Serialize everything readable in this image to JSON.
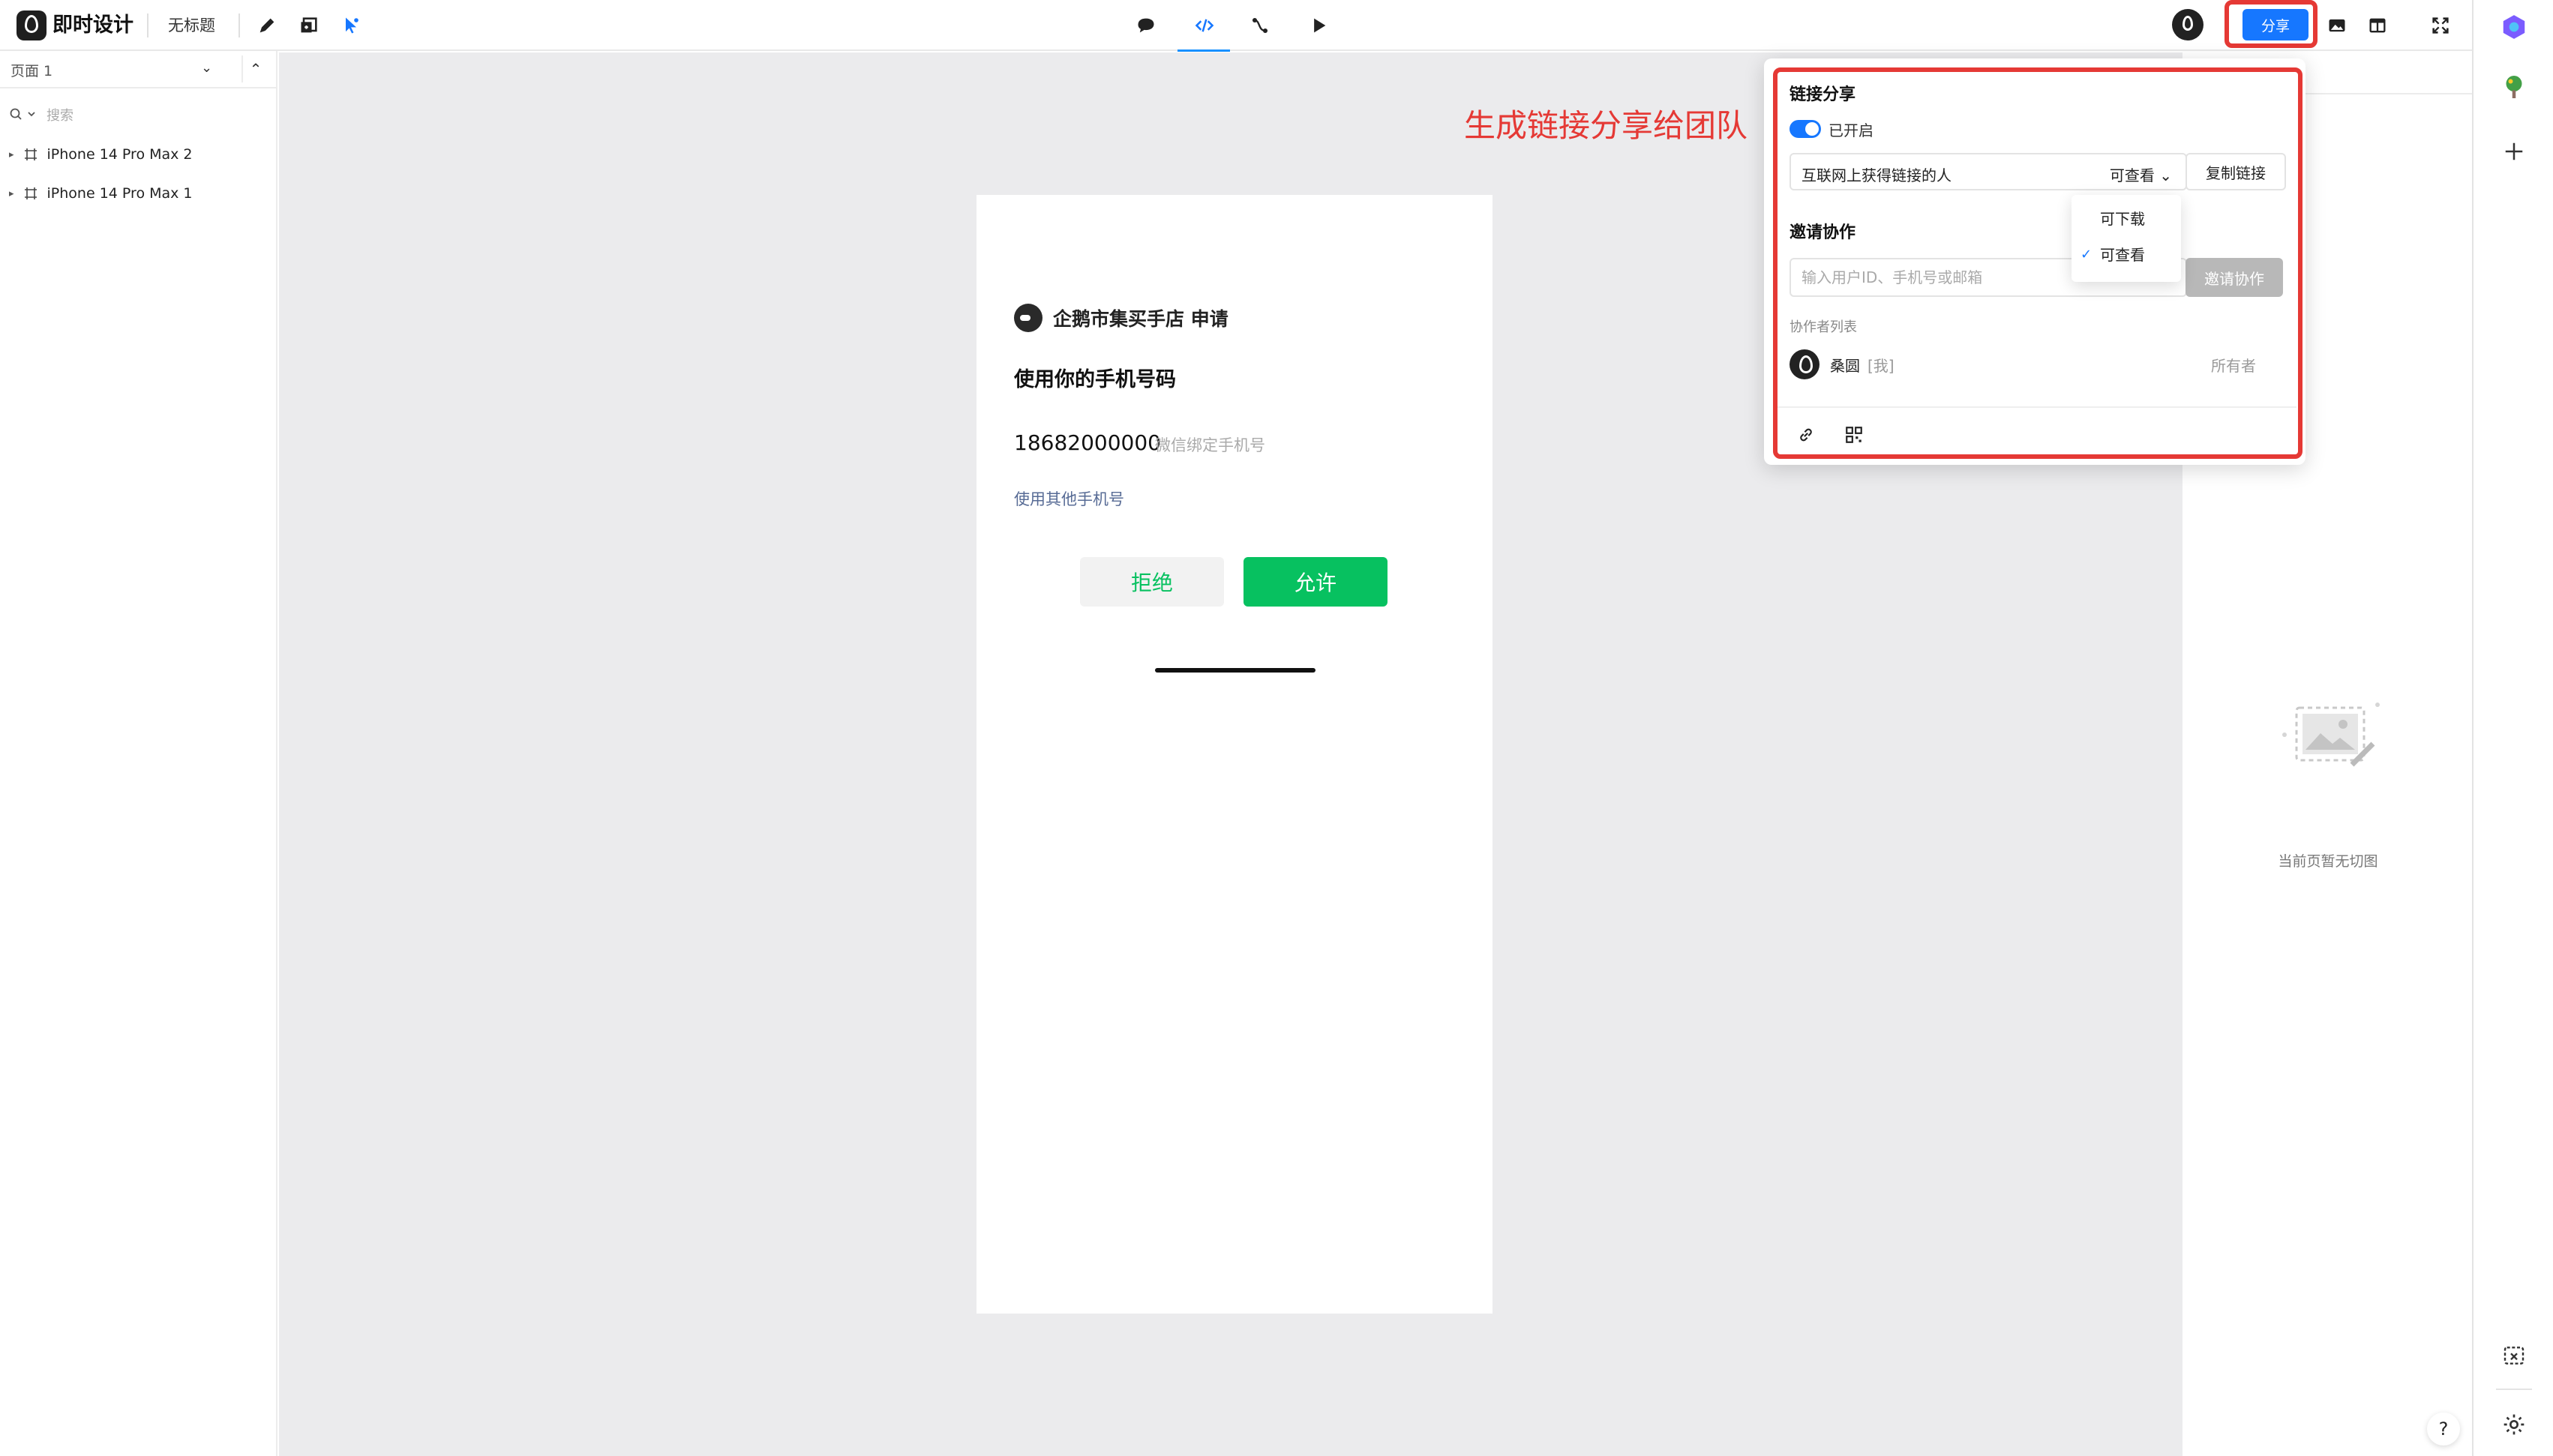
{
  "app": {
    "name": "即时设计",
    "doc_title": "无标题",
    "share_label": "分享"
  },
  "leftpanel": {
    "page_label": "页面 1",
    "search_placeholder": "搜索",
    "layers": [
      {
        "label": "iPhone 14 Pro Max 2"
      },
      {
        "label": "iPhone 14 Pro Max 1"
      }
    ]
  },
  "phone": {
    "app_line": "企鹅市集买手店 申请",
    "title": "使用你的手机号码",
    "number": "18682000000",
    "number_hint": "微信绑定手机号",
    "other_phone": "使用其他手机号",
    "reject": "拒绝",
    "allow": "允许"
  },
  "annotation": "生成链接分享给团队",
  "share_popup": {
    "title": "链接分享",
    "toggle_label": "已开启",
    "toggle_on": true,
    "who": "互联网上获得链接的人",
    "level": "可查看",
    "copy_link": "复制链接",
    "invite_title": "邀请协作",
    "invite_placeholder": "输入用户ID、手机号或邮箱",
    "invite_button": "邀请协作",
    "collab_list_label": "协作者列表",
    "collaborators": [
      {
        "name": "桑圆",
        "tag": "[我]",
        "role": "所有者"
      }
    ]
  },
  "perm_dropdown": {
    "options": [
      {
        "label": "可下载",
        "selected": false
      },
      {
        "label": "可查看",
        "selected": true
      }
    ]
  },
  "rightpanel": {
    "empty_text": "当前页暂无切图"
  },
  "colors": {
    "accent": "#1677ff",
    "wechat_green": "#07c160",
    "annotation_red": "#e53935"
  }
}
